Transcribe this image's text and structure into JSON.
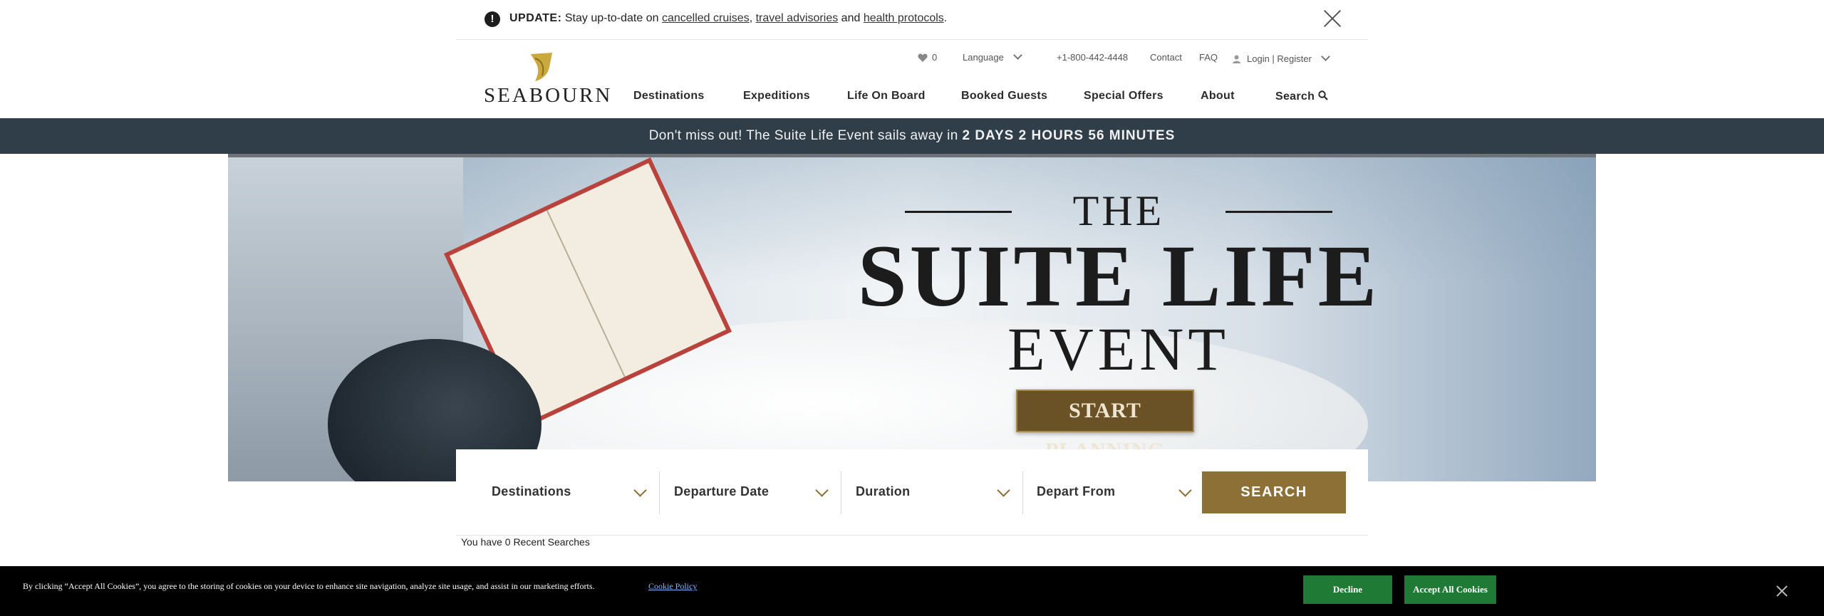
{
  "alert": {
    "label": "UPDATE:",
    "text_before": "Stay up-to-date on",
    "link_cruises": "cancelled cruises",
    "sep_comma": ",",
    "link_advisories": "travel advisories",
    "text_and": "and",
    "link_protocols": "health protocols",
    "text_end": ".",
    "icon": "exclamation-icon"
  },
  "utility": {
    "favorites_count": "0",
    "language": "Language",
    "phone": "+1-800-442-4448",
    "contact": "Contact",
    "faq": "FAQ",
    "login": "Login | Register"
  },
  "logo": {
    "text": "SEABOURN"
  },
  "nav": {
    "destinations": "Destinations",
    "expeditions": "Expeditions",
    "life_on_board": "Life On Board",
    "booked_guests": "Booked Guests",
    "special_offers": "Special Offers",
    "about": "About",
    "search": "Search"
  },
  "countdown": {
    "text": "Don't miss out! The Suite Life Event sails away in",
    "time": "2 DAYS 2 HOURS 56 MINUTES"
  },
  "hero": {
    "title_the": "THE",
    "title_main": "SUITE LIFE",
    "title_event": "EVENT",
    "cta": "START PLANNING"
  },
  "search": {
    "destinations": "Destinations",
    "departure_date": "Departure Date",
    "duration": "Duration",
    "depart_from": "Depart From",
    "button": "SEARCH",
    "recent": "You have 0 Recent Searches"
  },
  "cookie": {
    "text": "By clicking “Accept All Cookies”, you agree to the storing of cookies on your device to enhance site navigation, analyze site usage, and assist in our marketing efforts.",
    "policy_link": "Cookie Policy",
    "decline": "Decline",
    "accept": "Accept All Cookies"
  },
  "colors": {
    "brand_gold": "#8c7035",
    "countdown_bg": "#2f3e48",
    "cookie_accept": "#1e7a34"
  }
}
